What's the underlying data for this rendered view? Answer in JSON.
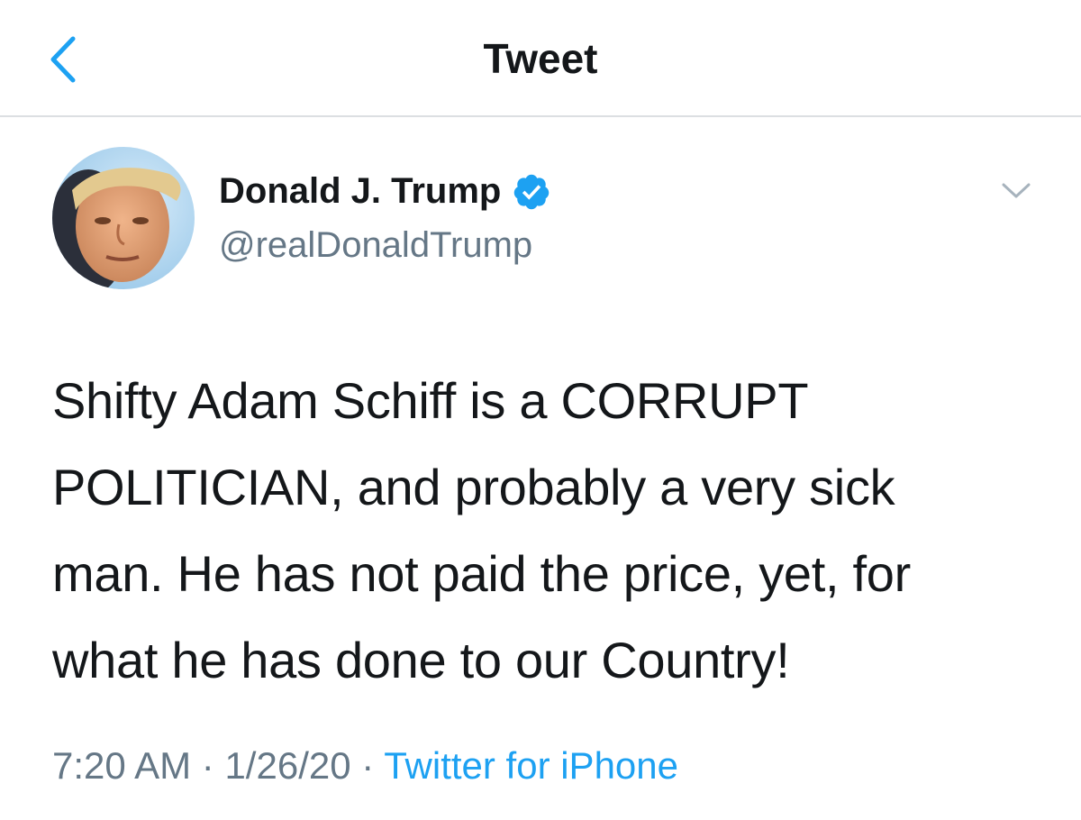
{
  "nav": {
    "title": "Tweet",
    "back_icon": "chevron-left-icon",
    "accent_color": "#1da1f2"
  },
  "tweet": {
    "author_name": "Donald J. Trump",
    "handle": "@realDonaldTrump",
    "verified": true,
    "verified_icon": "verified-badge-icon",
    "menu_icon": "chevron-down-icon",
    "text": "Shifty Adam Schiff is a CORRUPT\nPOLITICIAN, and probably a very sick\nman. He has not paid the price, yet, for\nwhat he has done to our Country!",
    "time": "7:20 AM",
    "date": "1/26/20",
    "separator": "·",
    "source": "Twitter for iPhone"
  }
}
